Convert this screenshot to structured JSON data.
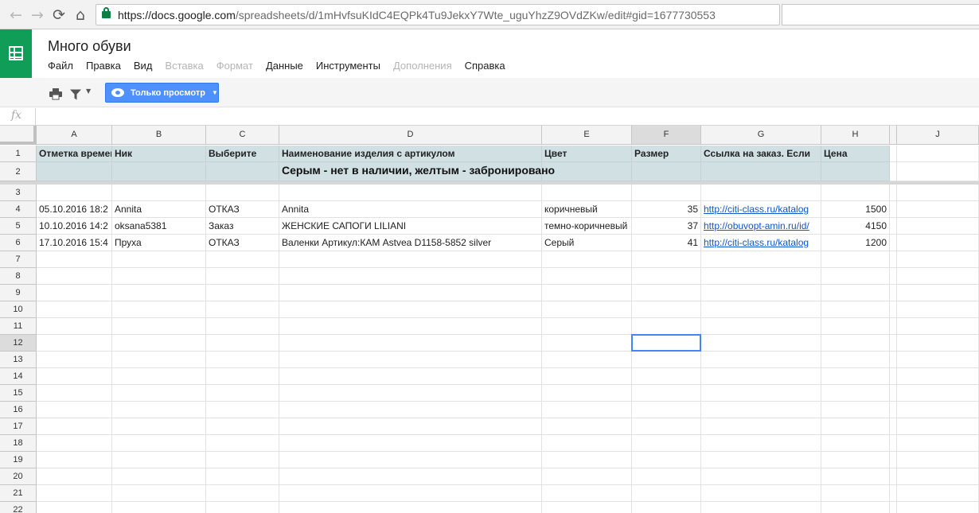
{
  "browser": {
    "back": "←",
    "forward": "→",
    "reload": "⟳",
    "home": "⌂",
    "url_host": "https://docs.google.com",
    "url_path": "/spreadsheets/d/1mHvfsuKIdC4EQPk4Tu9JekxY7Wte_uguYhzZ9OVdZKw/edit#gid=1677730553"
  },
  "app": {
    "title": "Много обуви",
    "menu": [
      "Файл",
      "Правка",
      "Вид",
      "Вставка",
      "Формат",
      "Данные",
      "Инструменты",
      "Дополнения",
      "Справка"
    ],
    "menu_disabled": [
      "Вставка",
      "Формат",
      "Дополнения"
    ]
  },
  "toolbar": {
    "print_icon": "printer-icon",
    "filter_icon": "filter-icon",
    "view_only_label": "Только просмотр"
  },
  "formula_bar": {
    "fx_label": "fx",
    "value": ""
  },
  "columns": [
    "A",
    "B",
    "C",
    "D",
    "E",
    "F",
    "G",
    "H",
    "",
    "J"
  ],
  "selected_column": "F",
  "selected_row": 12,
  "rows": [
    1,
    2,
    3,
    4,
    5,
    6,
    7,
    8,
    9,
    10,
    11,
    12,
    13,
    14,
    15,
    16,
    17,
    18,
    19,
    20,
    21,
    22
  ],
  "header_row": [
    "Отметка времени",
    "Ник",
    "Выберите",
    "Наименование изделия с артикулом",
    "Цвет",
    "Размер",
    "Ссылка на заказ. Если",
    "Цена"
  ],
  "banner": "Серым - нет в наличии, желтым - забронировано",
  "data_rows": [
    [
      "05.10.2016 18:2",
      "Annita",
      "ОТКАЗ",
      "Annita",
      "коричневый",
      "35",
      "http://citi-class.ru/katalog",
      "1500"
    ],
    [
      "10.10.2016 14:2",
      "oksana5381",
      "Заказ",
      "ЖЕНСКИЕ САПОГИ LILIANI",
      "темно-коричневый",
      "37",
      "http://obuvopt-amin.ru/id/",
      "4150"
    ],
    [
      "17.10.2016 15:4",
      "Пруха",
      "ОТКАЗ",
      "Валенки  Артикул:КАМ Astvea D1158-5852 silver",
      "Серый",
      "41",
      "http://citi-class.ru/katalog",
      "1200"
    ]
  ]
}
